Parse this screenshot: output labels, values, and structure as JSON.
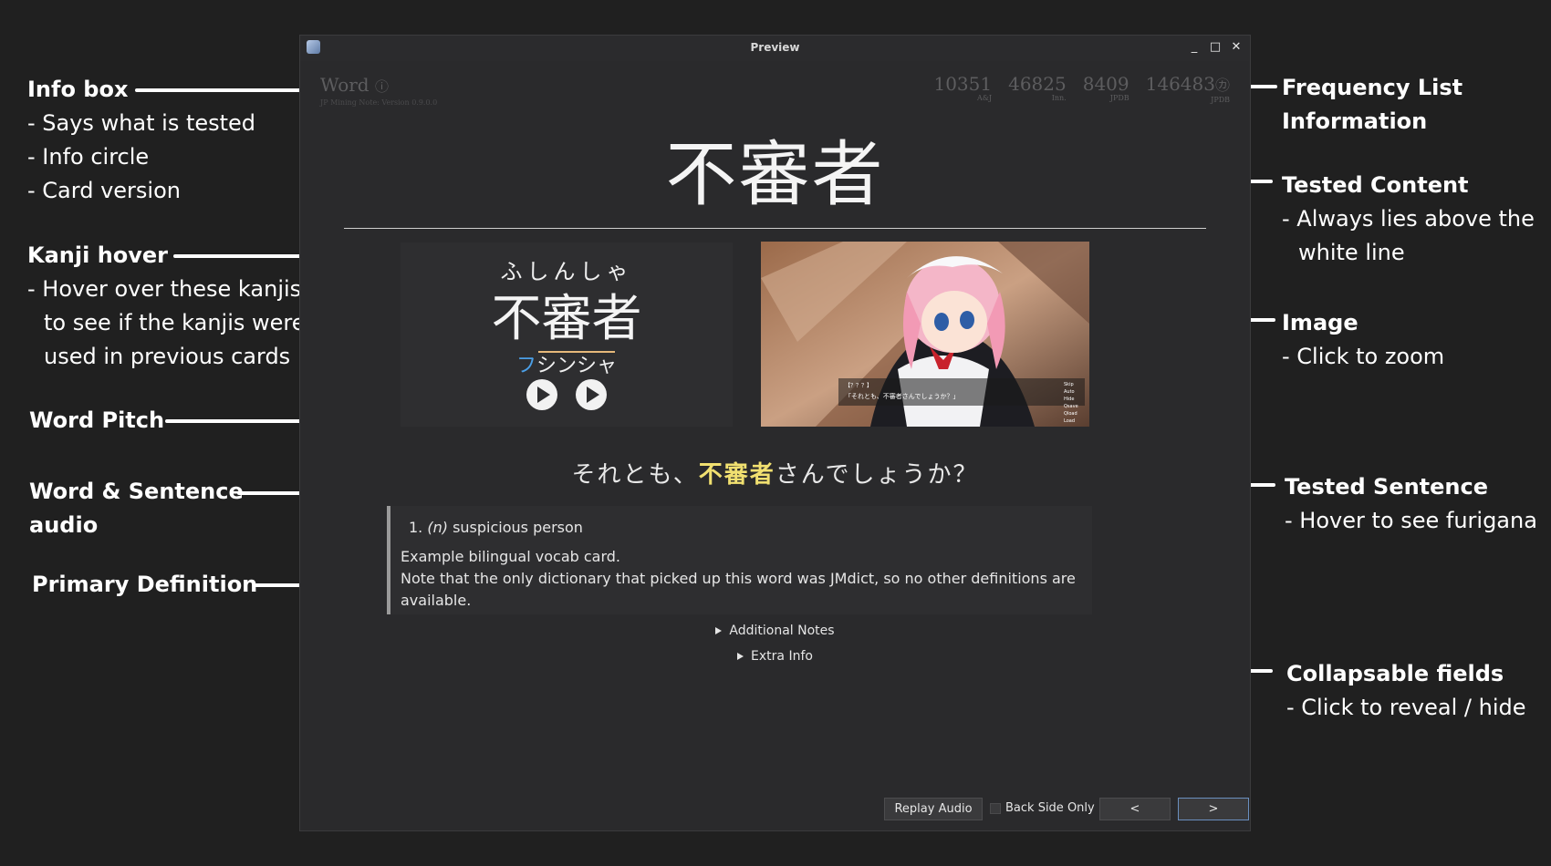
{
  "annotations": {
    "info_box": {
      "title": "Info box",
      "lines": [
        "- Says what is tested",
        "- Info circle",
        "- Card version"
      ]
    },
    "kanji_hover": {
      "title": "Kanji hover",
      "lines": [
        "- Hover over these kanjis",
        "to see if the kanjis were",
        "used in previous cards"
      ]
    },
    "word_pitch": {
      "title": "Word Pitch"
    },
    "audio": {
      "title_line1": "Word & Sentence",
      "title_line2": "audio"
    },
    "primary_definition": {
      "title": "Primary Definition"
    },
    "frequency": {
      "title_line1": "Frequency List",
      "title_line2": "Information"
    },
    "tested_content": {
      "title": "Tested Content",
      "lines": [
        "- Always lies above the",
        "white line"
      ]
    },
    "image": {
      "title": "Image",
      "lines": [
        "- Click to zoom"
      ]
    },
    "tested_sentence": {
      "title": "Tested Sentence",
      "lines": [
        "- Hover to see furigana"
      ]
    },
    "collapsable": {
      "title": "Collapsable fields",
      "lines": [
        "- Click to reveal / hide"
      ]
    }
  },
  "window": {
    "title": "Preview",
    "controls": {
      "minimize": "_",
      "maximize": "□",
      "close": "✕"
    }
  },
  "card": {
    "info_label": "Word",
    "info_icon": "ⓘ",
    "version": "JP Mining Note: Version 0.9.0.0",
    "frequencies": [
      {
        "value": "10351",
        "source": "A&J"
      },
      {
        "value": "46825",
        "source": "Inn."
      },
      {
        "value": "8409",
        "source": "JPDB"
      },
      {
        "value": "146483",
        "source": "JPDB",
        "icon": "㋕"
      }
    ],
    "word": "不審者",
    "furigana": "ふしんしゃ",
    "kanji": "不審者",
    "pitch": {
      "high": "フ",
      "rest": "シンシャ"
    },
    "sentence": {
      "before": "それとも、",
      "highlight": "不審者",
      "after": "さんでしょうか？"
    },
    "definition": {
      "number": "1.",
      "pos": "(n)",
      "gloss": "suspicious person",
      "note_line1": "Example bilingual vocab card.",
      "note_line2": "Note that the only dictionary that picked up this word was JMdict, so no other definitions are",
      "note_line3": "available."
    },
    "collapsibles": [
      "Additional Notes",
      "Extra Info"
    ]
  },
  "bottom_bar": {
    "replay_label": "Replay Audio",
    "back_side_label": "Back Side Only",
    "prev_label": "<",
    "next_label": ">"
  },
  "image_overlay": {
    "speaker": "【？？？】",
    "line": "「それとも、不審者さんでしょうか？」",
    "menu": [
      "Skip",
      "Auto",
      "Hide",
      "Qsave",
      "Qload",
      "Load"
    ]
  },
  "colors": {
    "background": "#202020",
    "window": "#2a2a2c",
    "highlight": "#f1e070",
    "pitch_high": "#4b9fe6"
  }
}
